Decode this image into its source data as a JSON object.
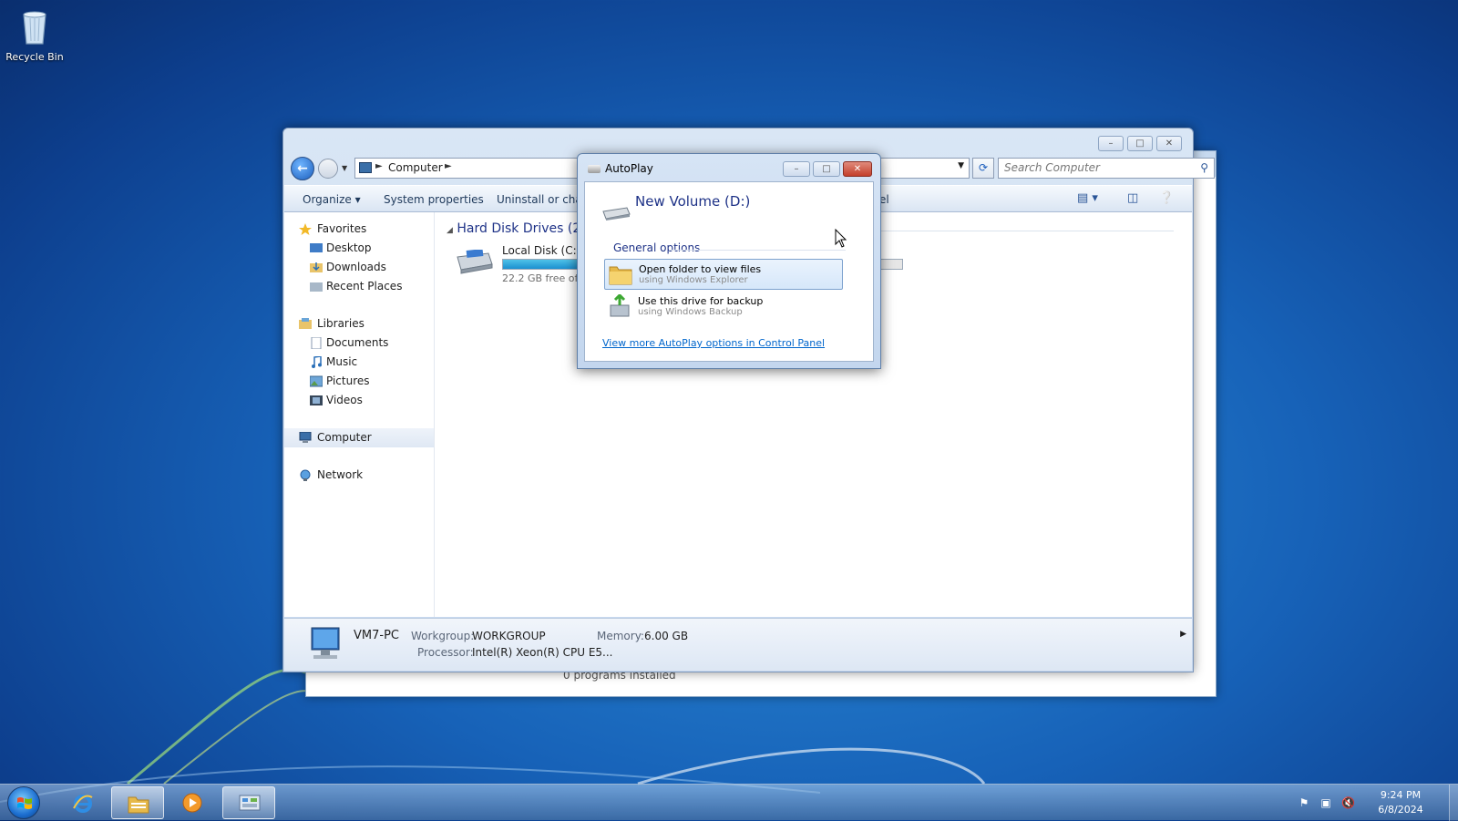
{
  "desktop": {
    "recycle_bin_label": "Recycle Bin"
  },
  "background_window": {
    "status_text": "0 programs installed"
  },
  "explorer": {
    "address": {
      "crumb": "Computer"
    },
    "search_placeholder": "Search Computer",
    "toolbar": {
      "organize": "Organize",
      "system_properties": "System properties",
      "uninstall": "Uninstall or cha",
      "hidden_item": "el"
    },
    "nav": {
      "favorites": "Favorites",
      "desktop": "Desktop",
      "downloads": "Downloads",
      "recent_places": "Recent Places",
      "libraries": "Libraries",
      "documents": "Documents",
      "music": "Music",
      "pictures": "Pictures",
      "videos": "Videos",
      "computer": "Computer",
      "network": "Network"
    },
    "group_header": "Hard Disk Drives (2)",
    "drive": {
      "name": "Local Disk (C:)",
      "free_text": "22.2 GB free of 3",
      "used_fraction": 0.55
    },
    "details": {
      "pc_name": "VM7-PC",
      "workgroup_label": "Workgroup:",
      "workgroup_value": "WORKGROUP",
      "memory_label": "Memory:",
      "memory_value": "6.00 GB",
      "processor_label": "Processor:",
      "processor_value": "Intel(R) Xeon(R) CPU E5..."
    }
  },
  "autoplay": {
    "title": "AutoPlay",
    "heading": "New Volume (D:)",
    "group": "General options",
    "options": [
      {
        "line1": "Open folder to view files",
        "line2": "using Windows Explorer",
        "icon": "folder-icon"
      },
      {
        "line1": "Use this drive for backup",
        "line2": "using Windows Backup",
        "icon": "backup-icon"
      }
    ],
    "link": "View more AutoPlay options in Control Panel"
  },
  "taskbar": {
    "clock_time": "9:24 PM",
    "clock_date": "6/8/2024",
    "pinned": [
      "internet-explorer-icon",
      "windows-explorer-icon",
      "media-player-icon",
      "control-panel-icon"
    ],
    "tray_icons": [
      "action-center-flag-icon",
      "network-icon",
      "volume-muted-icon"
    ]
  },
  "colors": {
    "accent_blue": "#1e3287",
    "link": "#0066cc",
    "close_red": "#c4402b",
    "drive_fill": "#1b8fd0"
  }
}
